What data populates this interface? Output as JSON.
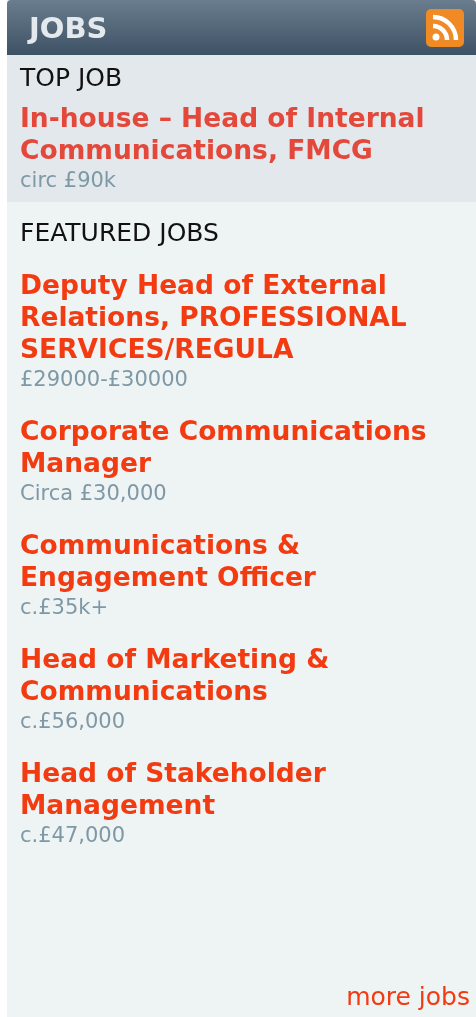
{
  "header": {
    "title": "JOBS"
  },
  "top_job": {
    "heading": "TOP JOB",
    "title": "In-house – Head of Internal Communications, FMCG",
    "salary": "circ £90k"
  },
  "featured": {
    "heading": "FEATURED JOBS",
    "jobs": [
      {
        "title": "Deputy Head of External Relations, PROFESSIONAL SERVICES/REGULA",
        "salary": "£29000-£30000"
      },
      {
        "title": "Corporate Communications Manager",
        "salary": "Circa £30,000"
      },
      {
        "title": "Communications & Engagement Officer",
        "salary": "c.£35k+"
      },
      {
        "title": "Head of Marketing & Communications",
        "salary": "c.£56,000"
      },
      {
        "title": "Head of Stakeholder Management",
        "salary": "c.£47,000"
      }
    ]
  },
  "more_link": "more jobs"
}
